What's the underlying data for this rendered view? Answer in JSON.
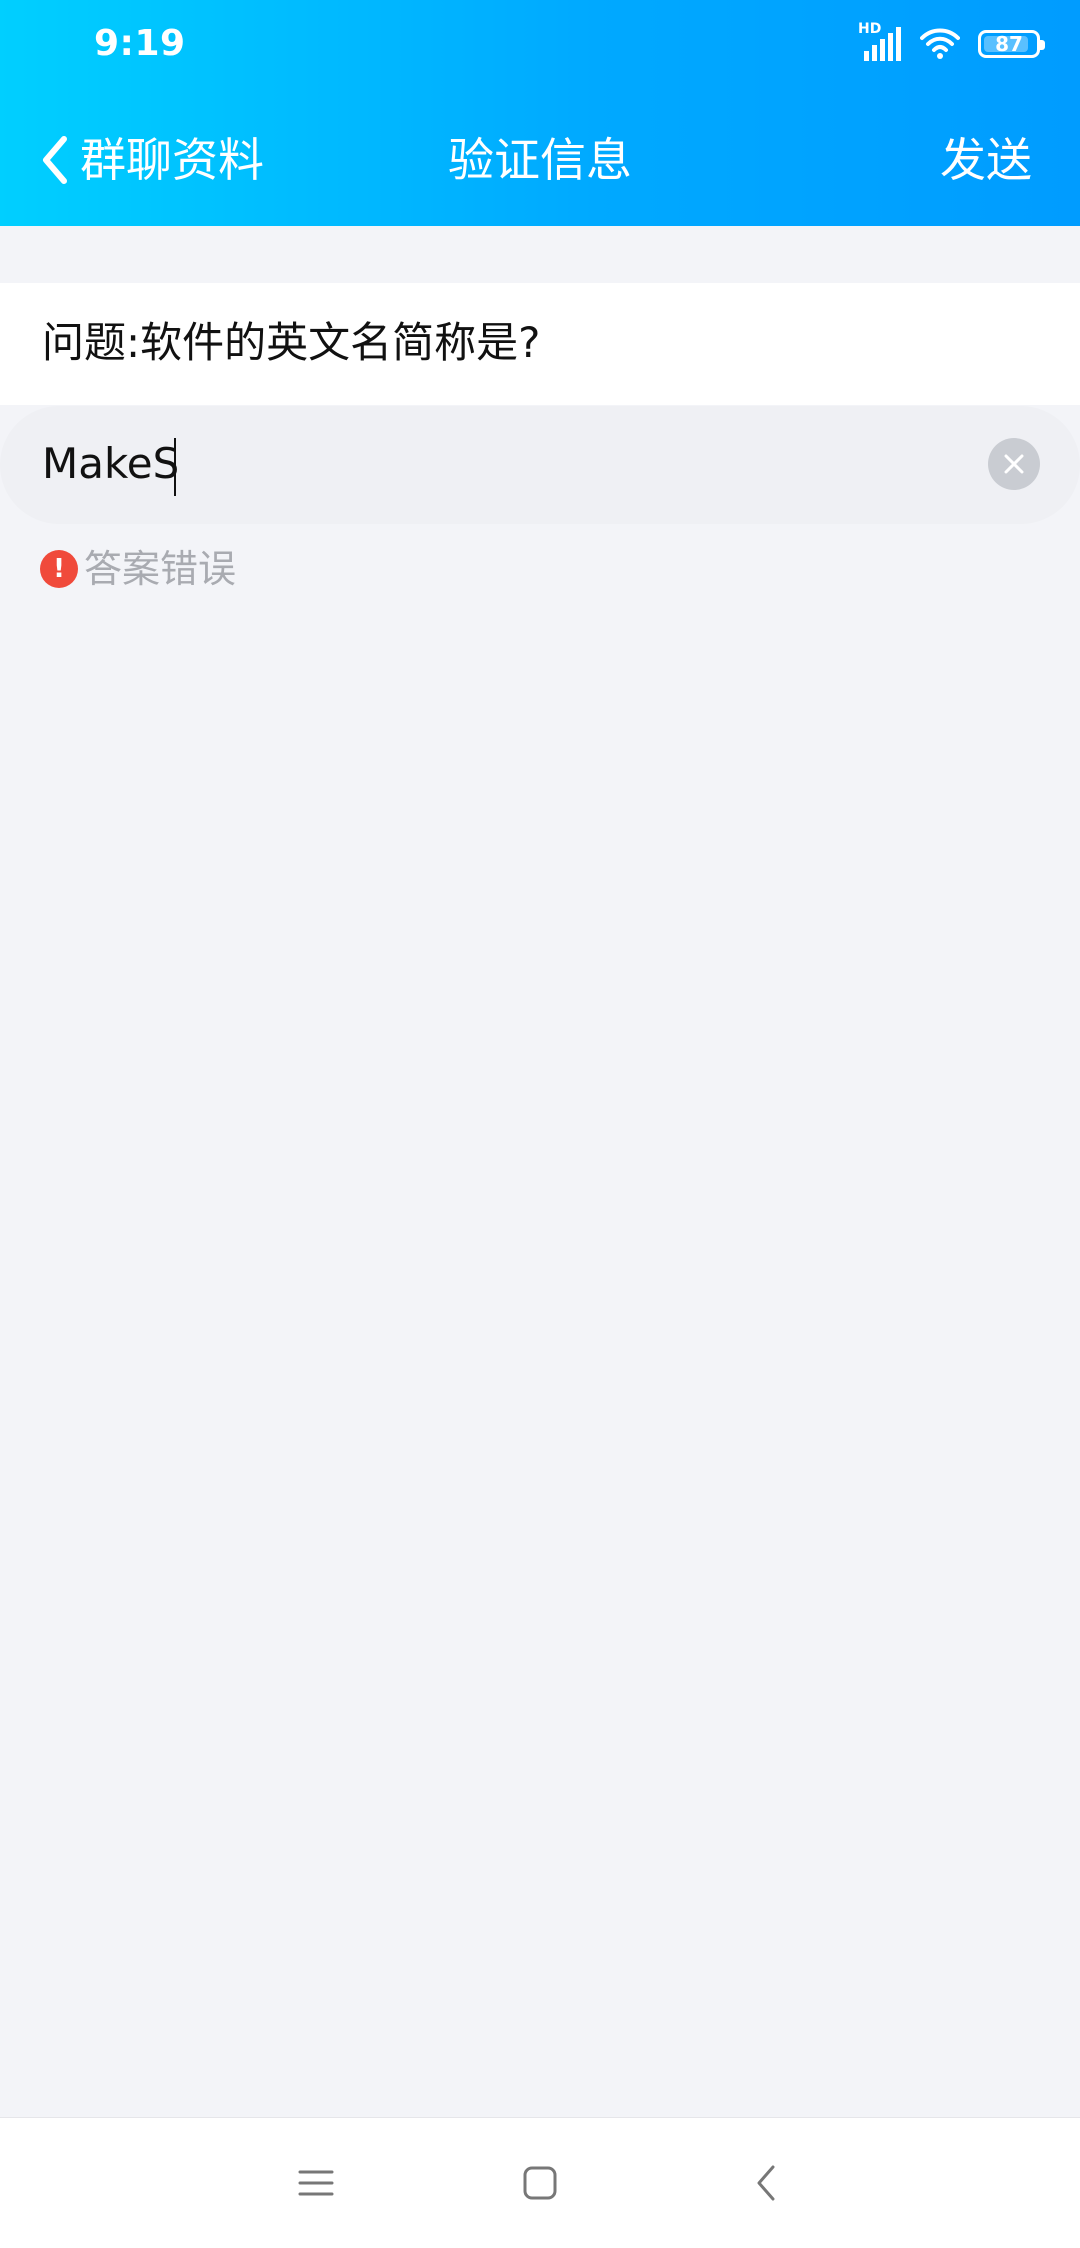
{
  "status_bar": {
    "time": "9:19",
    "network_label": "HD",
    "battery": "87",
    "battery_level_percent": 87,
    "icons": [
      "signal-icon",
      "wifi-icon",
      "battery-icon"
    ]
  },
  "header": {
    "back_label": "群聊资料",
    "title": "验证信息",
    "send_label": "发送"
  },
  "question": {
    "text": "问题:软件的英文名简称是?"
  },
  "answer": {
    "value": "MakeS",
    "clear_icon": "clear-icon"
  },
  "error": {
    "icon_label": "!",
    "text": "答案错误"
  },
  "colors": {
    "header_start": "#00CFFF",
    "header_end": "#009CFF",
    "page_bg": "#F3F4F8",
    "error_red": "#F04A3B",
    "muted_text": "#A9ABB1"
  },
  "nav": {
    "icons": [
      "menu-icon",
      "home-icon",
      "back-icon"
    ]
  }
}
